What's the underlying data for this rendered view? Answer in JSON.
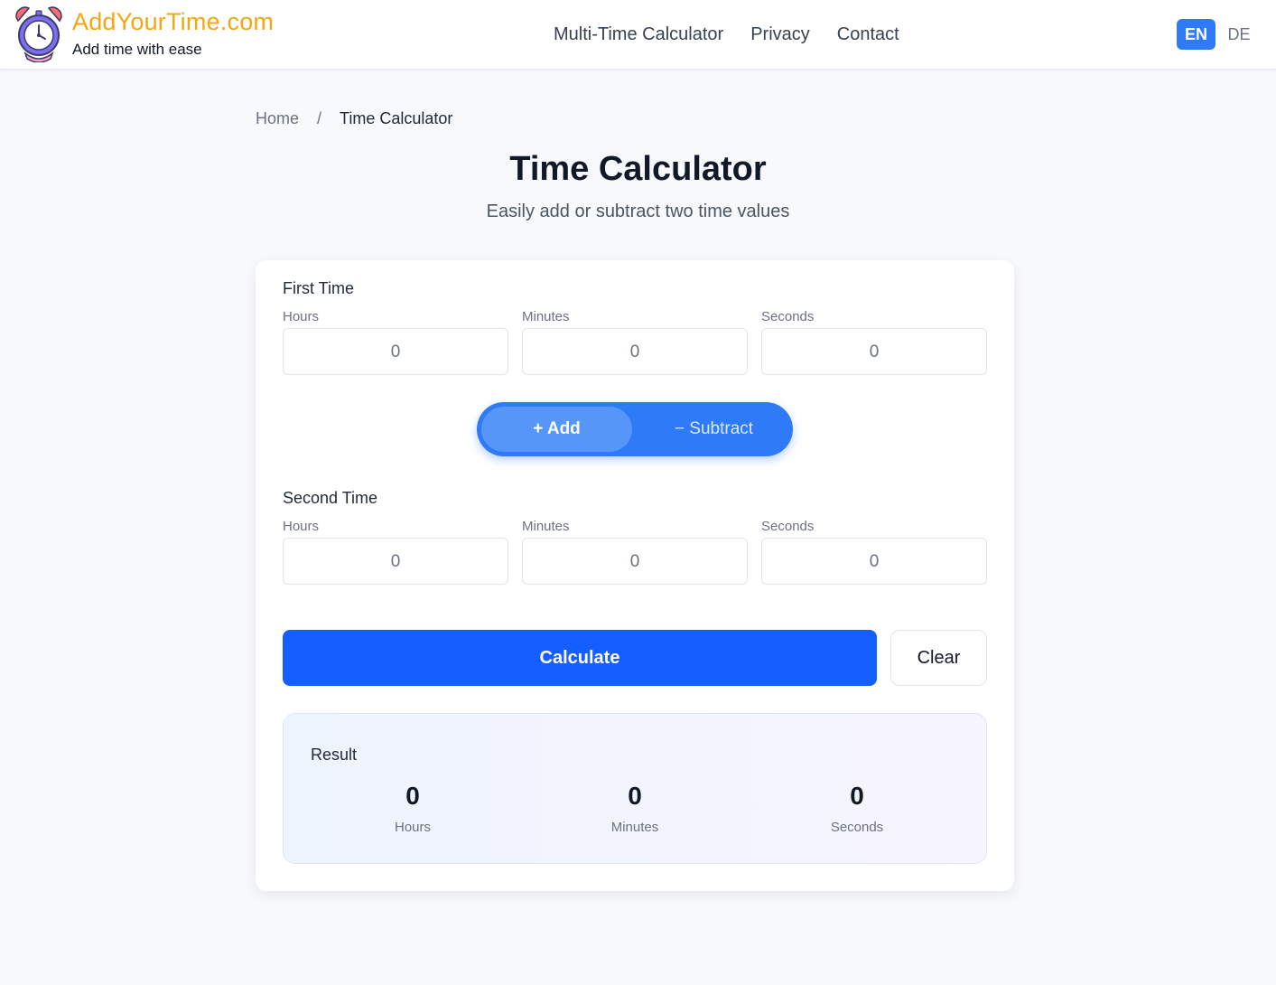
{
  "header": {
    "brand_name": "AddYourTime.com",
    "brand_tagline": "Add time with ease",
    "nav": [
      "Multi-Time Calculator",
      "Privacy",
      "Contact"
    ],
    "lang_en": "EN",
    "lang_de": "DE",
    "active_lang": "EN"
  },
  "breadcrumb": {
    "home": "Home",
    "separator": "/",
    "current": "Time Calculator"
  },
  "page": {
    "title": "Time Calculator",
    "subtitle": "Easily add or subtract two time values"
  },
  "calculator": {
    "first": {
      "title": "First Time",
      "hours_label": "Hours",
      "minutes_label": "Minutes",
      "seconds_label": "Seconds",
      "hours": "0",
      "minutes": "0",
      "seconds": "0"
    },
    "operation": {
      "add_label": "+ Add",
      "subtract_label": "− Subtract",
      "selected": "add"
    },
    "second": {
      "title": "Second Time",
      "hours_label": "Hours",
      "minutes_label": "Minutes",
      "seconds_label": "Seconds",
      "hours": "0",
      "minutes": "0",
      "seconds": "0"
    },
    "calculate_label": "Calculate",
    "clear_label": "Clear"
  },
  "result": {
    "title": "Result",
    "hours": "0",
    "hours_label": "Hours",
    "minutes": "0",
    "minutes_label": "Minutes",
    "seconds": "0",
    "seconds_label": "Seconds"
  },
  "colors": {
    "brand": "#f3a712",
    "accent": "#2f7af6",
    "primary_button": "#155eff"
  },
  "icons": {
    "logo": "alarm-clock-icon"
  }
}
